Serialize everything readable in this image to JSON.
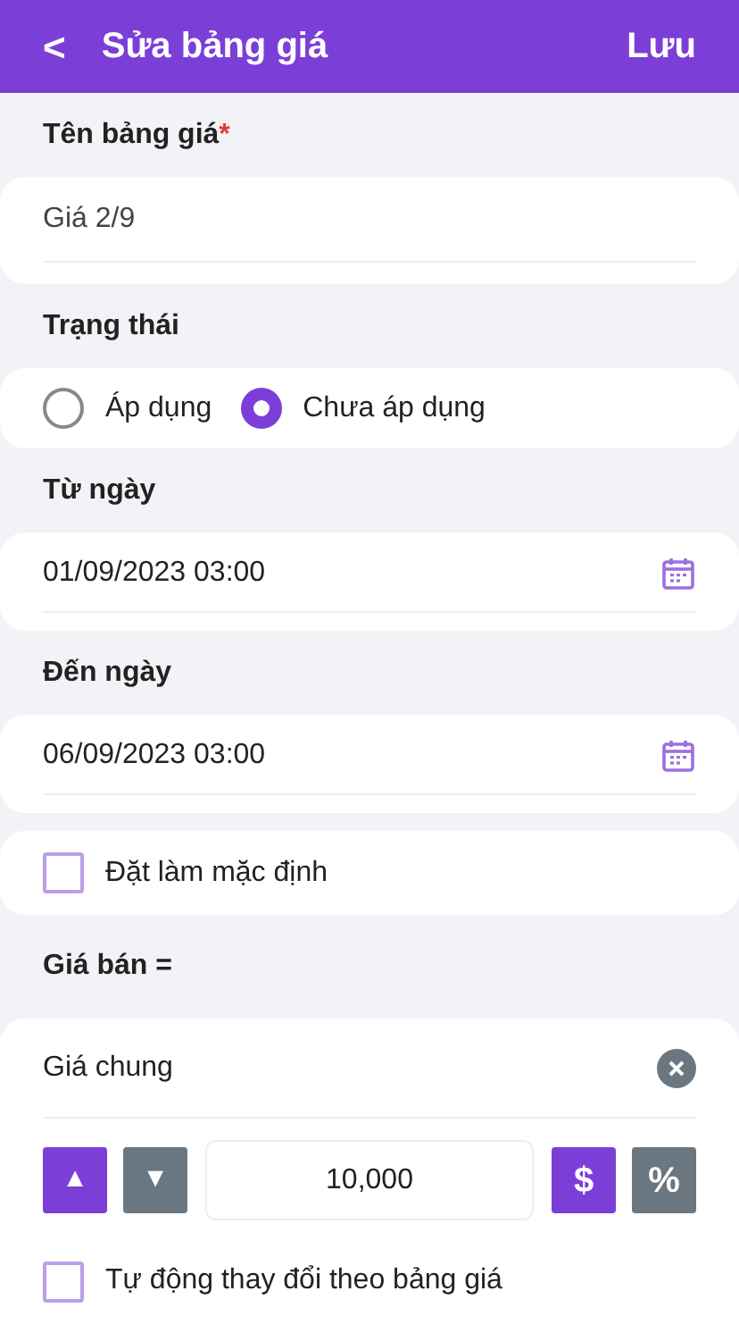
{
  "header": {
    "back": "<",
    "title": "Sửa bảng giá",
    "action": "Lưu"
  },
  "name_field": {
    "label": "Tên bảng giá",
    "required_mark": "*",
    "value": "Giá 2/9"
  },
  "status": {
    "label": "Trạng thái",
    "options": [
      {
        "label": "Áp dụng",
        "selected": false
      },
      {
        "label": "Chưa áp dụng",
        "selected": true
      }
    ]
  },
  "date_fields": [
    {
      "label": "Từ ngày",
      "value": "01/09/2023 03:00"
    },
    {
      "label": "Đến ngày",
      "value": "06/09/2023 03:00"
    }
  ],
  "default_checkbox": {
    "label": "Đặt làm mặc định",
    "checked": false
  },
  "price": {
    "label": "Giá bán =",
    "base": "Giá chung",
    "directions": [
      {
        "symbol": "▲",
        "selected": true
      },
      {
        "symbol": "▼",
        "selected": false
      }
    ],
    "amount": "10,000",
    "units": [
      {
        "symbol": "$",
        "selected": true
      },
      {
        "symbol": "%",
        "selected": false
      }
    ],
    "auto_checkbox": {
      "label": "Tự động thay đổi theo bảng giá",
      "checked": false
    }
  }
}
